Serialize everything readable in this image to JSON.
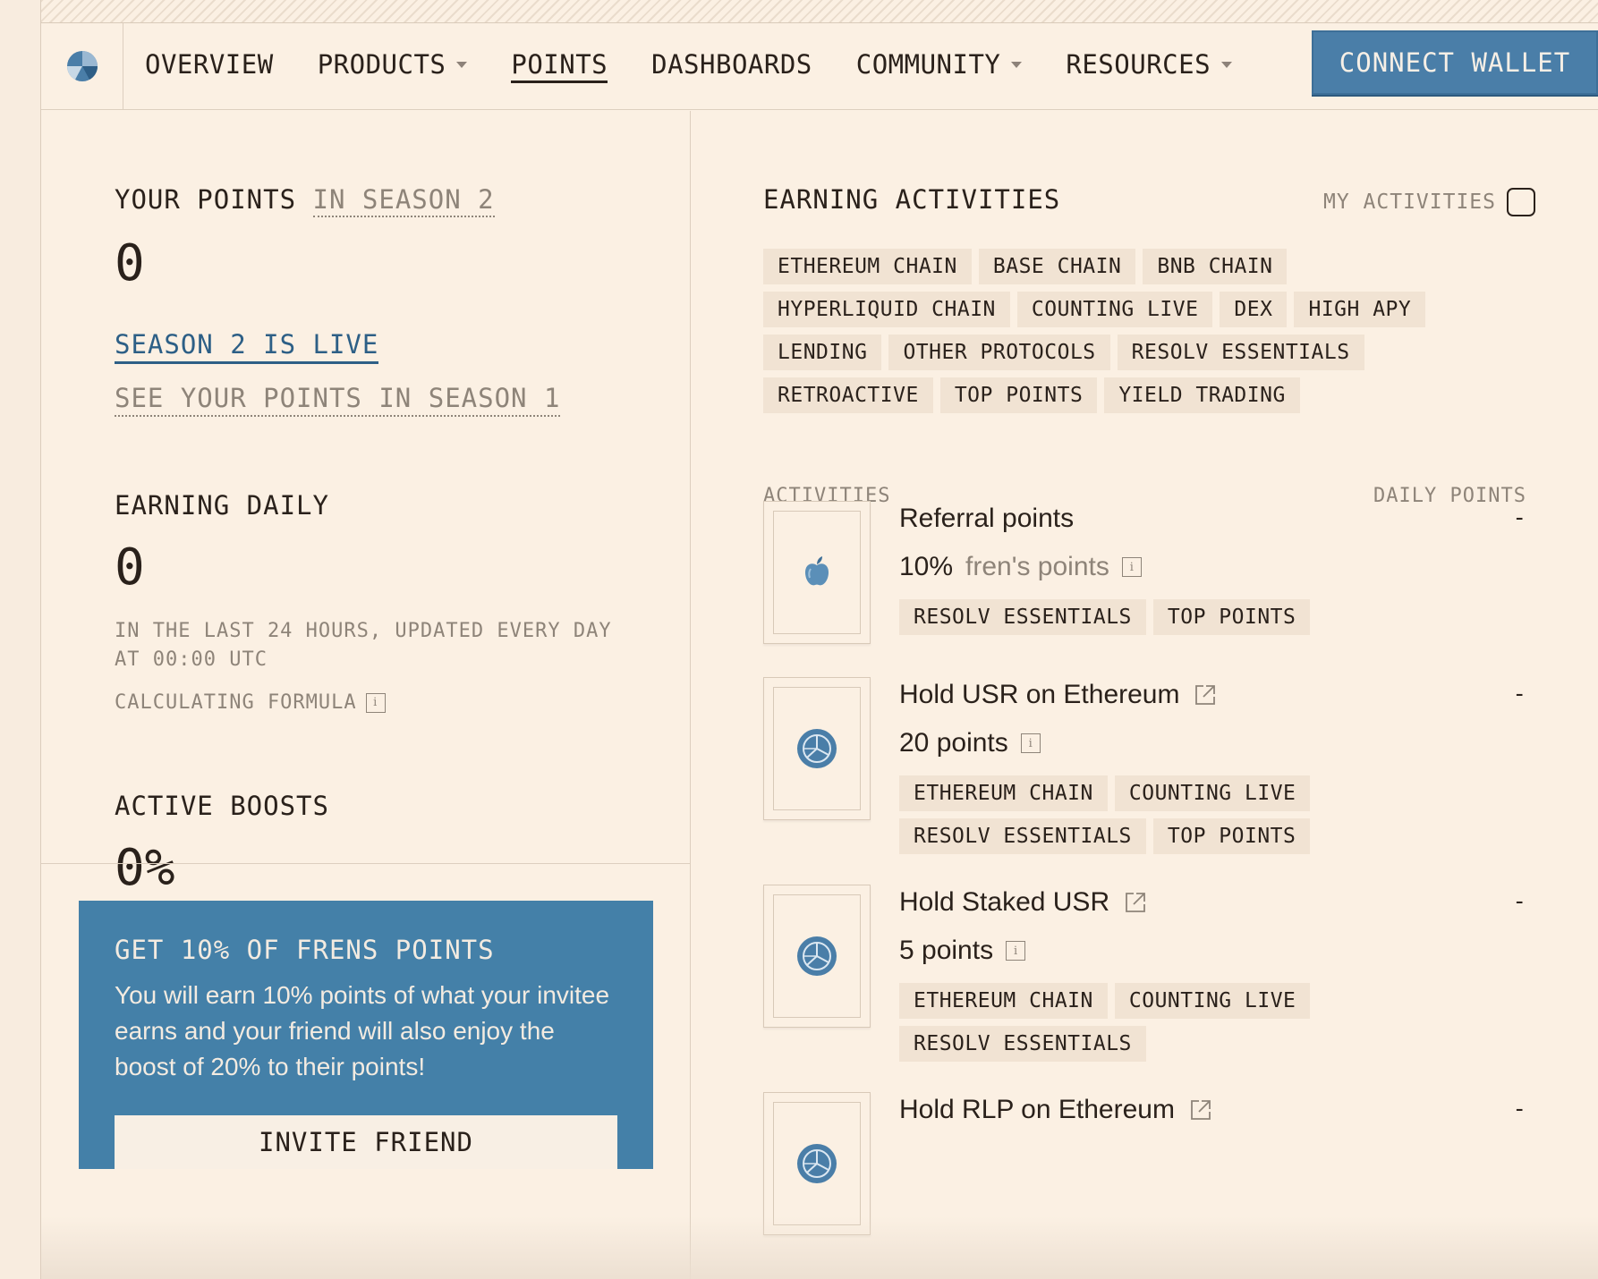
{
  "nav": {
    "items": [
      {
        "label": "OVERVIEW",
        "dropdown": false,
        "active": false
      },
      {
        "label": "PRODUCTS",
        "dropdown": true,
        "active": false
      },
      {
        "label": "POINTS",
        "dropdown": false,
        "active": true
      },
      {
        "label": "DASHBOARDS",
        "dropdown": false,
        "active": false
      },
      {
        "label": "COMMUNITY",
        "dropdown": true,
        "active": false
      },
      {
        "label": "RESOURCES",
        "dropdown": true,
        "active": false
      }
    ],
    "connect_label": "CONNECT WALLET"
  },
  "points": {
    "title": "YOUR POINTS",
    "season_label": "IN SEASON 2",
    "value": "0",
    "season_live": "SEASON 2 IS LIVE",
    "see_s1": "SEE YOUR POINTS IN SEASON 1"
  },
  "daily": {
    "title": "EARNING DAILY",
    "value": "0",
    "note_line1": "IN THE LAST 24 HOURS, UPDATED EVERY DAY",
    "note_line2": "AT 00:00 UTC",
    "formula": "CALCULATING FORMULA"
  },
  "boosts": {
    "title": "ACTIVE BOOSTS",
    "value": "0%"
  },
  "promo": {
    "title": "GET 10% OF FRENS POINTS",
    "text": "You will earn 10% points of what your invitee earns and your friend will also enjoy the boost of 20% to their points!",
    "button": "INVITE FRIEND"
  },
  "earning": {
    "title": "EARNING ACTIVITIES",
    "my_activities": "MY ACTIVITIES",
    "filters": [
      "ETHEREUM CHAIN",
      "BASE CHAIN",
      "BNB CHAIN",
      "HYPERLIQUID CHAIN",
      "COUNTING LIVE",
      "DEX",
      "HIGH APY",
      "LENDING",
      "OTHER PROTOCOLS",
      "RESOLV ESSENTIALS",
      "RETROACTIVE",
      "TOP POINTS",
      "YIELD TRADING"
    ],
    "col_activities": "ACTIVITIES",
    "col_daily": "DAILY POINTS"
  },
  "activities": [
    {
      "title": "Referral points",
      "value": "10%",
      "value_note": "fren's points",
      "external": false,
      "icon": "apple-icon",
      "daily": "-",
      "tags": [
        "RESOLV ESSENTIALS",
        "TOP POINTS"
      ]
    },
    {
      "title": "Hold USR on Ethereum",
      "value": "20 points",
      "value_note": "",
      "external": true,
      "icon": "resolv-coin-icon",
      "daily": "-",
      "tags": [
        "ETHEREUM CHAIN",
        "COUNTING LIVE",
        "RESOLV ESSENTIALS",
        "TOP POINTS"
      ]
    },
    {
      "title": "Hold Staked USR",
      "value": "5 points",
      "value_note": "",
      "external": true,
      "icon": "resolv-coin-icon",
      "daily": "-",
      "tags": [
        "ETHEREUM CHAIN",
        "COUNTING LIVE",
        "RESOLV ESSENTIALS"
      ]
    },
    {
      "title": "Hold RLP on Ethereum",
      "value": "",
      "value_note": "",
      "external": true,
      "icon": "resolv-coin-icon",
      "daily": "-",
      "tags": []
    }
  ],
  "colors": {
    "accent": "#4a7ea8",
    "link": "#2d5f86",
    "background": "#fbf0e3",
    "tag": "#f1e3d3"
  }
}
